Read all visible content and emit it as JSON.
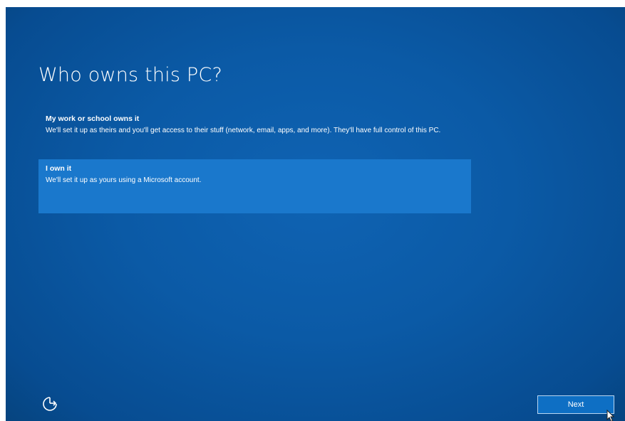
{
  "page": {
    "title": "Who owns this PC?"
  },
  "options": [
    {
      "title": "My work or school owns it",
      "description": "We'll set it up as theirs and you'll get access to their stuff (network, email, apps, and more). They'll have full control of this PC.",
      "selected": false
    },
    {
      "title": "I own it",
      "description": "We'll set it up as yours using a Microsoft account.",
      "selected": true
    }
  ],
  "footer": {
    "next_label": "Next",
    "ease_of_access_icon": "ease-of-access-icon"
  },
  "colors": {
    "background": "#0b5aa6",
    "selected_option": "#1a78cc",
    "text": "#ffffff"
  }
}
